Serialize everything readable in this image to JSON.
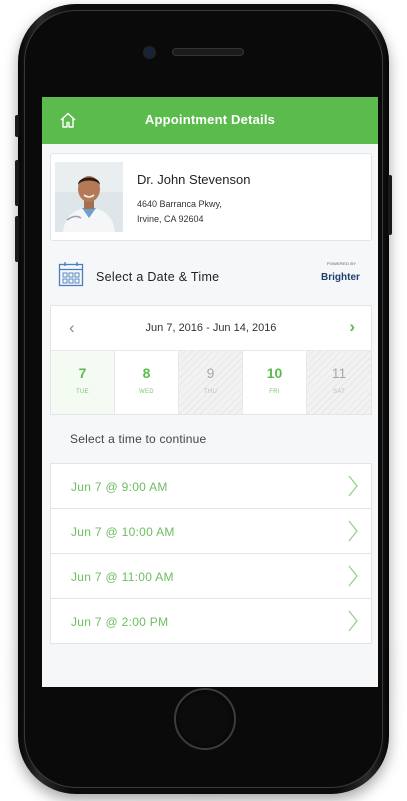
{
  "header": {
    "title": "Appointment Details",
    "home_icon": "home-icon",
    "color": "#5cbb4d"
  },
  "doctor": {
    "name": "Dr. John Stevenson",
    "address_line1": "4640 Barranca Pkwy,",
    "address_line2": "Irvine, CA 92604"
  },
  "scheduler": {
    "title": "Select a Date & Time",
    "calendar_icon": "calendar-icon",
    "powered_by": "POWERED BY",
    "brand": "Brighter",
    "date_range": "Jun 7, 2016 - Jun 14, 2016",
    "prev_icon": "chevron-left-icon",
    "next_icon": "chevron-right-icon",
    "days": [
      {
        "num": "7",
        "dow": "TUE",
        "state": "active"
      },
      {
        "num": "8",
        "dow": "WED",
        "state": "available"
      },
      {
        "num": "9",
        "dow": "THU",
        "state": "disabled"
      },
      {
        "num": "10",
        "dow": "FRI",
        "state": "available"
      },
      {
        "num": "11",
        "dow": "SAT",
        "state": "disabled"
      }
    ],
    "prompt": "Select a time to continue",
    "slots": [
      {
        "label": "Jun 7 @ 9:00 AM"
      },
      {
        "label": "Jun 7 @ 10:00 AM"
      },
      {
        "label": "Jun 7 @ 11:00 AM"
      },
      {
        "label": "Jun 7 @ 2:00 PM"
      }
    ]
  }
}
